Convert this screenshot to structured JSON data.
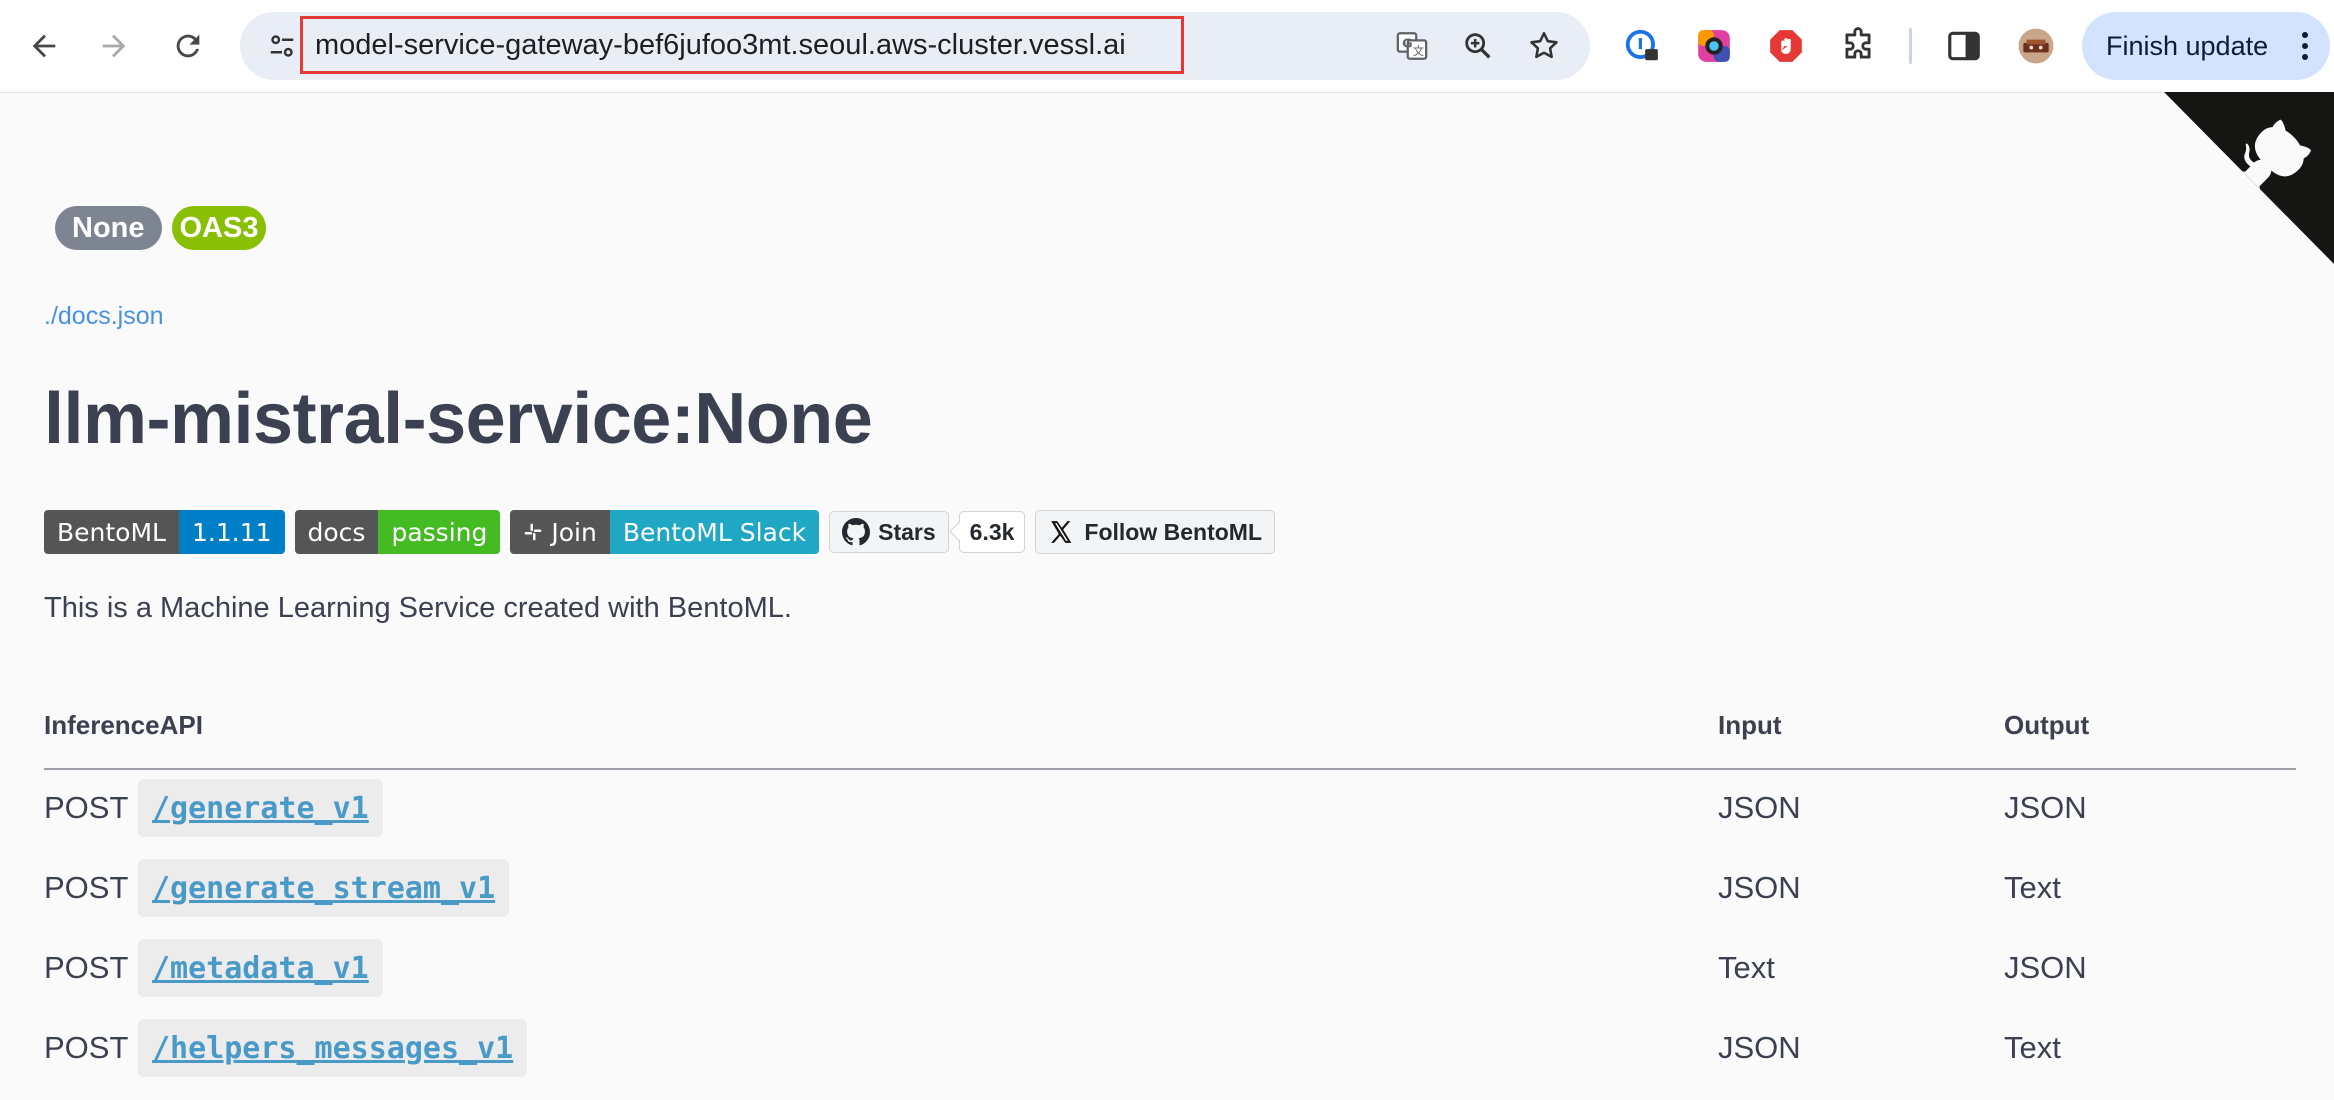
{
  "browser": {
    "url": "model-service-gateway-bef6jufoo3mt.seoul.aws-cluster.vessl.ai",
    "finish_update_label": "Finish update",
    "icons": {
      "back": "back-arrow-icon",
      "forward": "forward-arrow-icon",
      "reload": "reload-icon",
      "site_info": "tune-icon",
      "translate": "translate-icon",
      "zoom": "zoom-icon",
      "bookmark": "star-icon",
      "extensions": [
        "password-manager-icon",
        "color-picker-icon",
        "adblock-icon",
        "puzzle-icon"
      ],
      "side_panel": "side-panel-icon",
      "avatar": "avatar"
    }
  },
  "page": {
    "version_badge": "None",
    "spec_badge": "OAS3",
    "docs_link": "./docs.json",
    "title": "llm-mistral-service:None",
    "shields": {
      "bentoml_label": "BentoML",
      "bentoml_version": "1.1.11",
      "docs_label": "docs",
      "docs_status": "passing",
      "join_label": "Join",
      "slack_label": "BentoML Slack",
      "stars_label": "Stars",
      "stars_count": "6.3k",
      "follow_label": "Follow BentoML"
    },
    "description": "This is a Machine Learning Service created with BentoML.",
    "table": {
      "headers": {
        "api": "InferenceAPI",
        "input": "Input",
        "output": "Output"
      },
      "rows": [
        {
          "method": "POST",
          "path": "/generate_v1",
          "input": "JSON",
          "output": "JSON"
        },
        {
          "method": "POST",
          "path": "/generate_stream_v1",
          "input": "JSON",
          "output": "Text"
        },
        {
          "method": "POST",
          "path": "/metadata_v1",
          "input": "Text",
          "output": "JSON"
        },
        {
          "method": "POST",
          "path": "/helpers_messages_v1",
          "input": "JSON",
          "output": "Text"
        }
      ]
    }
  },
  "colors": {
    "url_highlight": "#e53935",
    "badge_grey": "#7d8492",
    "badge_green": "#89bf04",
    "link": "#4990e2",
    "endpoint": "#4a9ac7",
    "bentoml_blue": "#007ec6",
    "docs_green": "#4c1",
    "slack_teal": "#1fa7c4"
  }
}
